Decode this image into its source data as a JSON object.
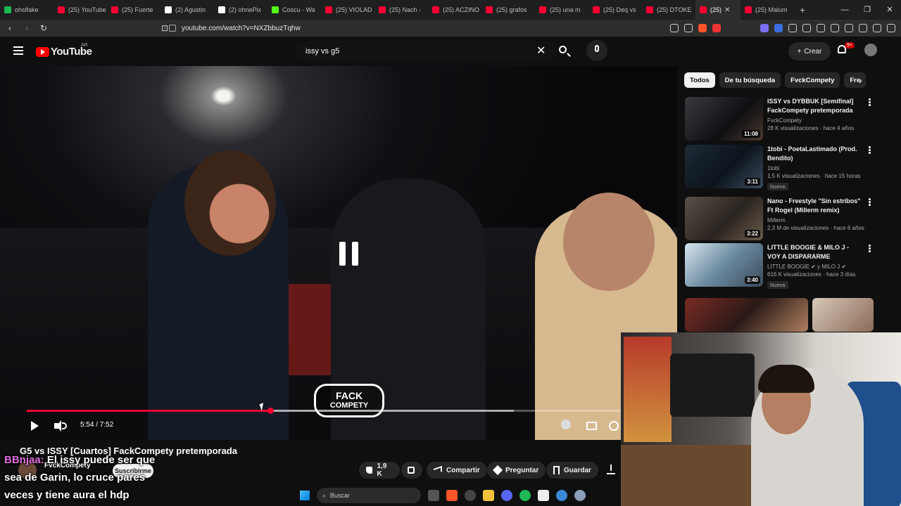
{
  "browser": {
    "tabs": [
      {
        "label": "ohsifake",
        "color": "#1db954"
      },
      {
        "label": "(25) YouTube",
        "color": "#ff0033"
      },
      {
        "label": "(25) Fuerte",
        "color": "#ff0033"
      },
      {
        "label": "(2) Agustin",
        "color": "#ffffff"
      },
      {
        "label": "(2) ohnePix",
        "color": "#ffffff"
      },
      {
        "label": "Coscu - Wa",
        "color": "#53fc18"
      },
      {
        "label": "(25) VIOLAD",
        "color": "#ff0033"
      },
      {
        "label": "(25) Nach -",
        "color": "#ff0033"
      },
      {
        "label": "(25) ACZINO",
        "color": "#ff0033"
      },
      {
        "label": "(25) grafos",
        "color": "#ff0033"
      },
      {
        "label": "(25) una m",
        "color": "#ff0033"
      },
      {
        "label": "(25) Deq vs",
        "color": "#ff0033"
      },
      {
        "label": "(25) DTOKE",
        "color": "#ff0033"
      }
    ],
    "active_tab": {
      "label": "(25)",
      "color": "#ff0033"
    },
    "last_tab": {
      "label": "(25) Malum",
      "color": "#ff0033"
    },
    "new_tab": "+",
    "url": "youtube.com/watch?v=NXZbbuzTqhw"
  },
  "youtube": {
    "logo_text": "YouTube",
    "country": "AR",
    "search_query": "issy vs g5",
    "create_label": "Crear",
    "notifications_badge": "9+"
  },
  "player": {
    "current_time": "5:54",
    "duration": "7:52",
    "time_label": "5:54 / 7:52",
    "played_fraction": 0.41,
    "loaded_fraction": 0.82,
    "overlay_logo_line1": "FACK",
    "overlay_logo_line2": "COMPETY"
  },
  "video": {
    "title": "G5 vs ISSY [Cuartos] FackCompety pretemporada",
    "channel": "FvckCompety",
    "subscribe_label": "Suscribirme",
    "likes": "1,9 K",
    "share_label": "Compartir",
    "ask_label": "Preguntar",
    "save_label": "Guardar"
  },
  "chat": {
    "user": "BBnjaa:",
    "line1": "El issy puede ser que",
    "line2": "sea de Garin, lo cruce pares",
    "line3": "veces y tiene aura el hdp"
  },
  "chips": [
    "Todos",
    "De tu búsqueda",
    "FvckCompety",
    "Fre"
  ],
  "recommendations": [
    {
      "title": "ISSY vs DYBBUK [Semifinal] FackCompety pretemporada",
      "channel": "FvckCompety",
      "meta": "28 K visualizaciones · hace 4 años",
      "duration": "11:08",
      "badge": ""
    },
    {
      "title": "1tobi - PoetaLastimado (Prod. Bendito)",
      "channel": "1tobi",
      "meta": "1,5 K visualizaciones · hace 15 horas",
      "duration": "3:11",
      "badge": "Nuevo"
    },
    {
      "title": "Nano - Freestyle \"Sin estribos\" Ft Rogel (Millerm remix)",
      "channel": "Millerm",
      "meta": "2,3 M de visualizaciones · hace 6 años",
      "duration": "3:22",
      "badge": ""
    },
    {
      "title": "LITTLE BOOGIE & MILO J - VOY A DISPARARME (VIDEOCLIP ...",
      "channel": "LITTLE BOOGIE ✔ y MILO J ✔",
      "meta": "616 K visualizaciones · hace 3 días",
      "duration": "3:40",
      "badge": "Nuevo"
    }
  ],
  "taskbar": {
    "search_placeholder": "Buscar"
  }
}
